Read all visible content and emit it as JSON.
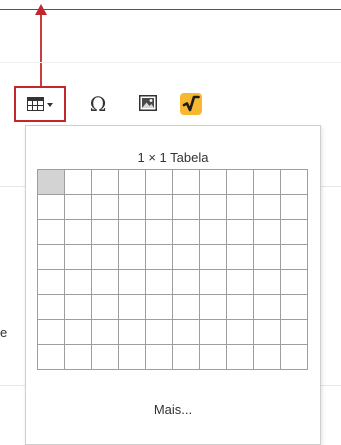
{
  "toolbar": {
    "table_button": {
      "icon": "table-icon"
    },
    "special_char": {
      "icon": "omega-icon",
      "glyph": "Ω"
    },
    "image_button": {
      "icon": "image-icon"
    },
    "math_button": {
      "icon": "math-formula-icon",
      "glyph": "√"
    }
  },
  "table_picker": {
    "title": "1 × 1 Tabela",
    "rows": 8,
    "columns": 10,
    "selected_rows": 1,
    "selected_columns": 1,
    "more_label": "Mais..."
  },
  "background": {
    "partial_text": "e"
  },
  "colors": {
    "highlight": "#c0282d",
    "selected_cell": "#d3d3d3",
    "grid_line": "#9e9e9e",
    "math_icon_bg": "#f7b731"
  }
}
